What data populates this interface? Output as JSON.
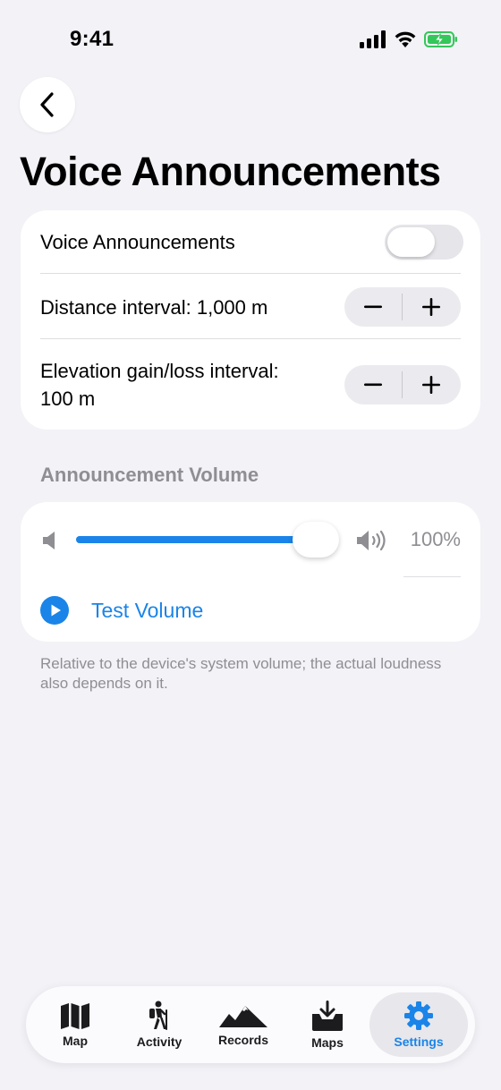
{
  "status_bar": {
    "time": "9:41"
  },
  "page": {
    "title": "Voice Announcements"
  },
  "settings": {
    "voice_toggle_label": "Voice Announcements",
    "voice_toggle_on": false,
    "distance_label": "Distance interval: 1,000 m",
    "elevation_label_line1": "Elevation gain/loss interval:",
    "elevation_label_line2": "100 m"
  },
  "volume": {
    "section_title": "Announcement Volume",
    "level": 1.0,
    "percent_text": "100%",
    "test_label": "Test Volume",
    "footnote": "Relative to the device's system volume; the actual loudness also depends on it."
  },
  "colors": {
    "accent": "#1a84e8",
    "background": "#f2f2f7",
    "secondary_text": "#8e8e93",
    "battery": "#34c759"
  },
  "tab_bar": {
    "items": [
      {
        "label": "Map",
        "icon": "map-icon",
        "active": false
      },
      {
        "label": "Activity",
        "icon": "hiker-icon",
        "active": false
      },
      {
        "label": "Records",
        "icon": "mountains-icon",
        "active": false
      },
      {
        "label": "Maps",
        "icon": "download-tray-icon",
        "active": false
      },
      {
        "label": "Settings",
        "icon": "gear-icon",
        "active": true
      }
    ]
  }
}
